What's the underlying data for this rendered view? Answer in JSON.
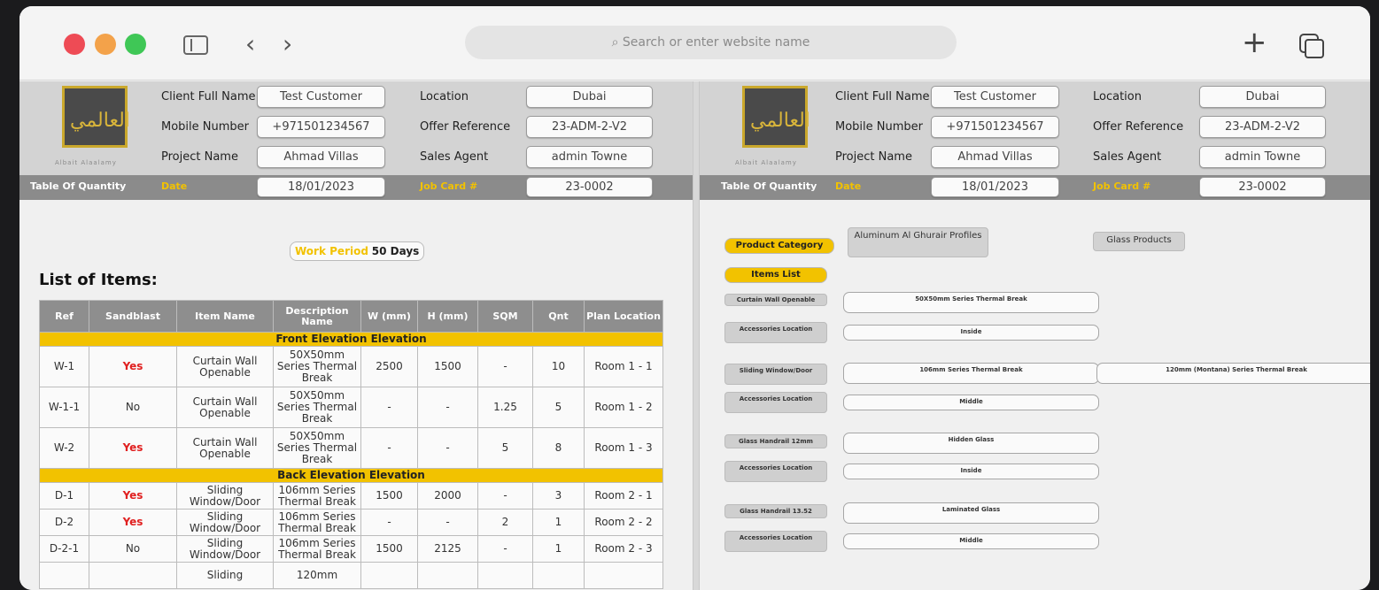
{
  "browser": {
    "address_placeholder": "Search or enter website name",
    "search_icon": "⌕"
  },
  "header": {
    "client_label": "Client Full Name",
    "client_value": "Test Customer",
    "mobile_label": "Mobile Number",
    "mobile_value": "+971501234567",
    "project_label": "Project Name",
    "project_value": "Ahmad Villas",
    "location_label": "Location",
    "location_value": "Dubai",
    "offer_label": "Offer Reference",
    "offer_value": "23-ADM-2-V2",
    "agent_label": "Sales Agent",
    "agent_value": "admin Towne",
    "toq_label": "Table Of Quantity",
    "date_label": "Date",
    "date_value": "18/01/2023",
    "job_label": "Job Card #",
    "job_value": "23-0002",
    "logo_caption": "Albait Alaalamy"
  },
  "work_period": {
    "label": "Work Period",
    "value": "50 Days"
  },
  "list_title": "List of Items:",
  "table": {
    "columns": [
      "Ref",
      "Sandblast",
      "Item Name",
      "Description Name",
      "W (mm)",
      "H (mm)",
      "SQM",
      "Qnt",
      "Plan Location"
    ],
    "section1": "Front Elevation Elevation",
    "section2": "Back Elevation Elevation",
    "rows": [
      [
        "W-1",
        "Yes",
        "Curtain Wall Openable",
        "50X50mm Series Thermal Break",
        "2500",
        "1500",
        "-",
        "10",
        "Room 1 - 1"
      ],
      [
        "W-1-1",
        "No",
        "Curtain Wall Openable",
        "50X50mm Series Thermal Break",
        "-",
        "-",
        "1.25",
        "5",
        "Room 1 - 2"
      ],
      [
        "W-2",
        "Yes",
        "Curtain Wall Openable",
        "50X50mm Series Thermal Break",
        "-",
        "-",
        "5",
        "8",
        "Room 1 - 3"
      ],
      [
        "D-1",
        "Yes",
        "Sliding Window/Door",
        "106mm Series Thermal Break",
        "1500",
        "2000",
        "-",
        "3",
        "Room 2 - 1"
      ],
      [
        "D-2",
        "Yes",
        "Sliding Window/Door",
        "106mm Series Thermal Break",
        "-",
        "-",
        "2",
        "1",
        "Room 2 - 2"
      ],
      [
        "D-2-1",
        "No",
        "Sliding Window/Door",
        "106mm Series Thermal Break",
        "1500",
        "2125",
        "-",
        "1",
        "Room 2 - 3"
      ],
      [
        "",
        "",
        "Sliding",
        "120mm",
        "",
        "",
        "",
        "",
        ""
      ]
    ]
  },
  "right": {
    "product_category_label": "Product Category",
    "category_1": "Aluminum Al Ghurair Profiles",
    "category_2": "Glass Products",
    "items_list_label": "Items List",
    "groups": [
      {
        "label": "Curtain Wall Openable",
        "options": [
          "50X50mm Series Thermal Break"
        ]
      },
      {
        "label": "Accessories Location",
        "options": [
          "Inside"
        ]
      },
      {
        "label": "Sliding Window/Door",
        "options": [
          "106mm Series Thermal Break",
          "120mm (Montana) Series Thermal Break"
        ]
      },
      {
        "label": "Accessories Location",
        "options": [
          "Middle"
        ]
      },
      {
        "label": "Glass Handrail 12mm",
        "options": [
          "Hidden Glass"
        ]
      },
      {
        "label": "Accessories Location",
        "options": [
          "Inside"
        ]
      },
      {
        "label": "Glass Handrail 13.52",
        "options": [
          "Laminated Glass"
        ]
      },
      {
        "label": "Accessories Location",
        "options": [
          "Middle"
        ]
      }
    ]
  }
}
